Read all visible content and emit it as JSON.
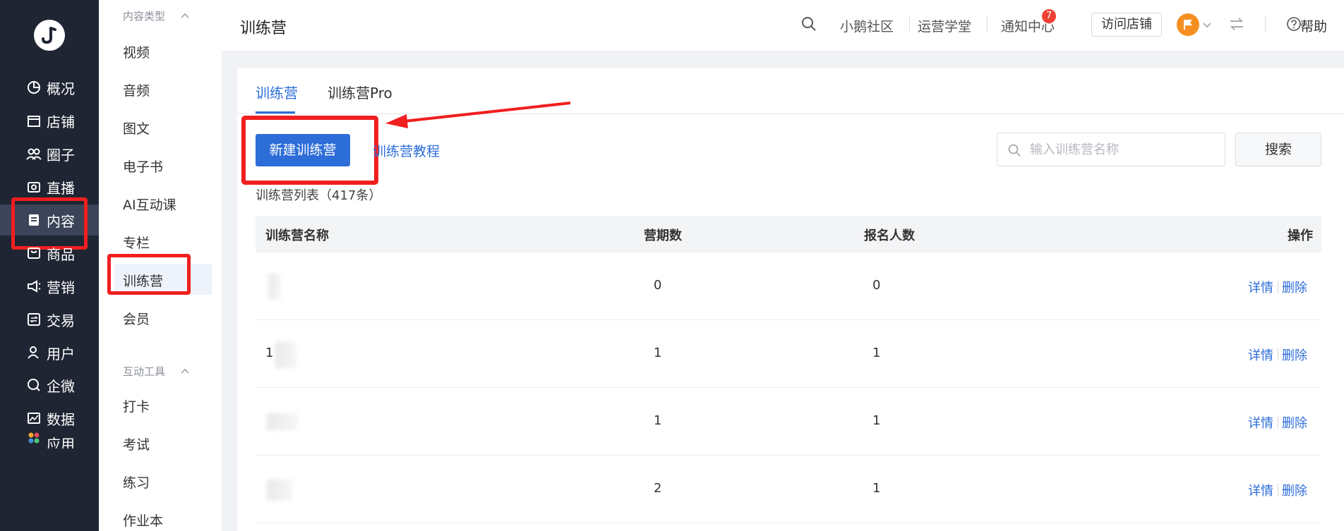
{
  "nav": {
    "items": [
      {
        "label": "概况",
        "icon": "pie-chart-icon"
      },
      {
        "label": "店铺",
        "icon": "store-icon"
      },
      {
        "label": "圈子",
        "icon": "group-icon"
      },
      {
        "label": "直播",
        "icon": "live-camera-icon"
      },
      {
        "label": "内容",
        "icon": "content-doc-icon"
      },
      {
        "label": "商品",
        "icon": "product-box-icon"
      },
      {
        "label": "营销",
        "icon": "megaphone-icon"
      },
      {
        "label": "交易",
        "icon": "exchange-icon"
      },
      {
        "label": "用户",
        "icon": "user-icon"
      },
      {
        "label": "企微",
        "icon": "wecom-icon"
      },
      {
        "label": "数据",
        "icon": "data-chart-icon"
      },
      {
        "label": "应用",
        "icon": "apps-icon"
      }
    ],
    "active_index": 4
  },
  "submenu": {
    "group1": "内容类型",
    "group1_items": [
      "视频",
      "音频",
      "图文",
      "电子书",
      "AI互动课",
      "专栏",
      "训练营",
      "会员"
    ],
    "active_item": "训练营",
    "group2": "互动工具",
    "group2_items": [
      "打卡",
      "考试",
      "练习",
      "作业本"
    ]
  },
  "header": {
    "title": "训练营",
    "links": [
      "小鹅社区",
      "运营学堂",
      "通知中心"
    ],
    "notification_count": "7",
    "visit_store": "访问店铺",
    "help": "帮助"
  },
  "tabs": [
    "训练营",
    "训练营Pro"
  ],
  "toolbar": {
    "create_label": "新建训练营",
    "tutorial_label": "训练营教程",
    "search_placeholder": "输入训练营名称",
    "search_button": "搜索"
  },
  "list_count": "训练营列表（417条）",
  "table": {
    "headers": [
      "训练营名称",
      "营期数",
      "报名人数",
      "操作"
    ],
    "rows": [
      {
        "name": "",
        "periods": "0",
        "signups": "0"
      },
      {
        "name": "1",
        "periods": "1",
        "signups": "1"
      },
      {
        "name": "",
        "periods": "1",
        "signups": "1"
      },
      {
        "name": "",
        "periods": "2",
        "signups": "1"
      }
    ],
    "action_detail": "详情",
    "action_delete": "删除"
  },
  "colors": {
    "nav_bg": "#1f2533",
    "accent": "#2d6dd8",
    "highlight": "#f11f1f"
  }
}
